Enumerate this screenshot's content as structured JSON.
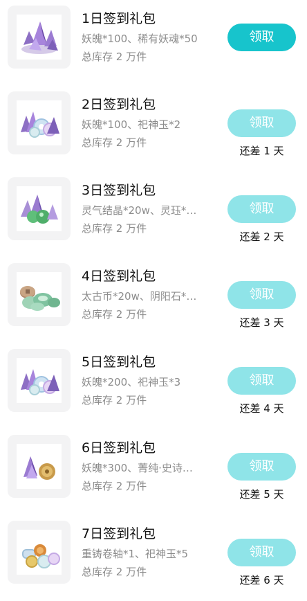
{
  "gifts": [
    {
      "title": "1日签到礼包",
      "desc": "妖魄*100、稀有妖魂*50",
      "stock": "总库存 2 万件",
      "button": "领取",
      "button_state": "active",
      "note": "",
      "icon": "gift-icon-purple-crystal"
    },
    {
      "title": "2日签到礼包",
      "desc": "妖魄*100、祀神玉*2",
      "stock": "总库存 2 万件",
      "button": "领取",
      "button_state": "disabled",
      "note": "还差 1 天",
      "icon": "gift-icon-crystal-jade"
    },
    {
      "title": "3日签到礼包",
      "desc": "灵气结晶*20w、灵珏*…",
      "stock": "总库存 2 万件",
      "button": "领取",
      "button_state": "disabled",
      "note": "还差 2 天",
      "icon": "gift-icon-green-crystal"
    },
    {
      "title": "4日签到礼包",
      "desc": "太古币*20w、阴阳石*…",
      "stock": "总库存 2 万件",
      "button": "领取",
      "button_state": "disabled",
      "note": "还差 3 天",
      "icon": "gift-icon-coins"
    },
    {
      "title": "5日签到礼包",
      "desc": "妖魄*200、祀神玉*3",
      "stock": "总库存 2 万件",
      "button": "领取",
      "button_state": "disabled",
      "note": "还差 4 天",
      "icon": "gift-icon-crystal-jade"
    },
    {
      "title": "6日签到礼包",
      "desc": "妖魄*300、菁纯·史诗…",
      "stock": "总库存 2 万件",
      "button": "领取",
      "button_state": "disabled",
      "note": "还差 5 天",
      "icon": "gift-icon-crystal-seal"
    },
    {
      "title": "7日签到礼包",
      "desc": "重铸卷轴*1、祀神玉*5",
      "stock": "总库存 2 万件",
      "button": "领取",
      "button_state": "disabled",
      "note": "还差 6 天",
      "icon": "gift-icon-scroll-jade"
    }
  ],
  "colors": {
    "button_active": "#17c4cc",
    "button_disabled": "#8fe4e8",
    "thumb_bg": "#f3f3f4",
    "secondary_text": "#8c8c8c"
  }
}
